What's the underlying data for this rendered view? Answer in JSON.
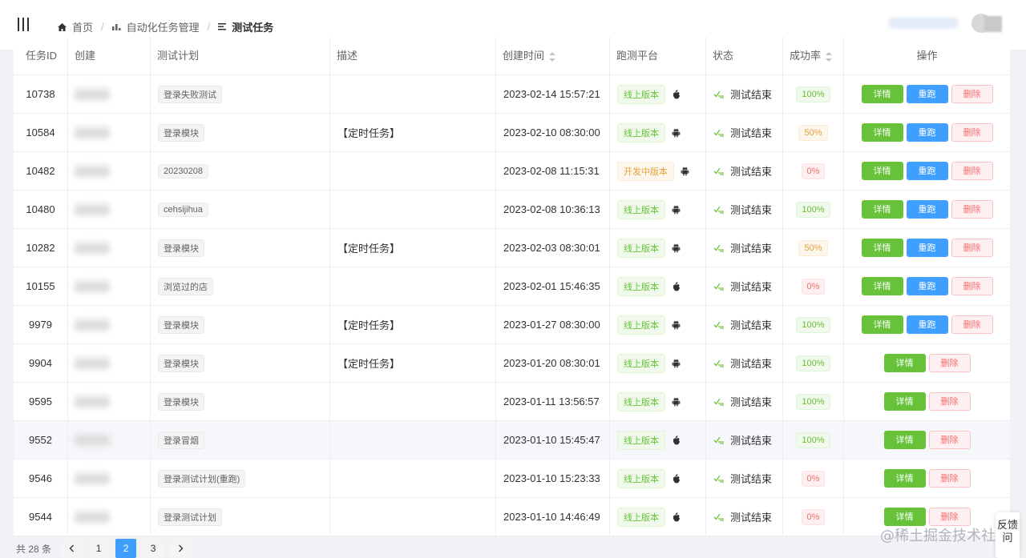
{
  "breadcrumb": {
    "home": "首页",
    "section": "自动化任务管理",
    "current": "测试任务"
  },
  "table": {
    "headers": {
      "id": "任务ID",
      "creator": "创建",
      "plan": "测试计划",
      "desc": "描述",
      "time": "创建时间",
      "platform": "跑测平台",
      "status": "状态",
      "rate": "成功率",
      "ops": "操作"
    },
    "rows": [
      {
        "id": "10738",
        "plan": "登录失败测试",
        "desc": "",
        "time": "2023-02-14 15:57:21",
        "platform": "线上版本",
        "os": "apple",
        "status": "测试结束",
        "rate": "100%"
      },
      {
        "id": "10584",
        "plan": "登录模块",
        "desc": "【定时任务】",
        "time": "2023-02-10 08:30:00",
        "platform": "线上版本",
        "os": "android",
        "status": "测试结束",
        "rate": "50%"
      },
      {
        "id": "10482",
        "plan": "20230208",
        "desc": "",
        "time": "2023-02-08 11:15:31",
        "platform": "开发中版本",
        "os": "android",
        "status": "测试结束",
        "rate": "0%"
      },
      {
        "id": "10480",
        "plan": "cehsijihua",
        "desc": "",
        "time": "2023-02-08 10:36:13",
        "platform": "线上版本",
        "os": "android",
        "status": "测试结束",
        "rate": "100%"
      },
      {
        "id": "10282",
        "plan": "登录模块",
        "desc": "【定时任务】",
        "time": "2023-02-03 08:30:01",
        "platform": "线上版本",
        "os": "android",
        "status": "测试结束",
        "rate": "50%"
      },
      {
        "id": "10155",
        "plan": "浏览过的店",
        "desc": "",
        "time": "2023-02-01 15:46:35",
        "platform": "线上版本",
        "os": "apple",
        "status": "测试结束",
        "rate": "0%"
      },
      {
        "id": "9979",
        "plan": "登录模块",
        "desc": "【定时任务】",
        "time": "2023-01-27 08:30:00",
        "platform": "线上版本",
        "os": "android",
        "status": "测试结束",
        "rate": "100%"
      },
      {
        "id": "9904",
        "plan": "登录模块",
        "desc": "【定时任务】",
        "time": "2023-01-20 08:30:01",
        "platform": "线上版本",
        "os": "android",
        "status": "测试结束",
        "rate": "100%"
      },
      {
        "id": "9595",
        "plan": "登录模块",
        "desc": "",
        "time": "2023-01-11 13:56:57",
        "platform": "线上版本",
        "os": "android",
        "status": "测试结束",
        "rate": "100%"
      },
      {
        "id": "9552",
        "plan": "登录冒烟",
        "desc": "",
        "time": "2023-01-10 15:45:47",
        "platform": "线上版本",
        "os": "apple",
        "status": "测试结束",
        "rate": "100%"
      },
      {
        "id": "9546",
        "plan": "登录测试计划(重跑)",
        "desc": "",
        "time": "2023-01-10 15:23:33",
        "platform": "线上版本",
        "os": "apple",
        "status": "测试结束",
        "rate": "0%"
      },
      {
        "id": "9544",
        "plan": "登录测试计划",
        "desc": "",
        "time": "2023-01-10 14:46:49",
        "platform": "线上版本",
        "os": "apple",
        "status": "测试结束",
        "rate": "0%"
      }
    ]
  },
  "buttons": {
    "detail": "详情",
    "rerun": "重跑",
    "delete": "删除"
  },
  "pagination": {
    "total": "共 28 条",
    "pages": [
      "1",
      "2",
      "3"
    ],
    "current": "2"
  },
  "watermark": "@稀土掘金技术社区",
  "feedback": "反馈问",
  "colors": {
    "success": "#67c23a",
    "primary": "#409eff",
    "danger": "#f56c6c",
    "warning": "#e6a23c"
  }
}
